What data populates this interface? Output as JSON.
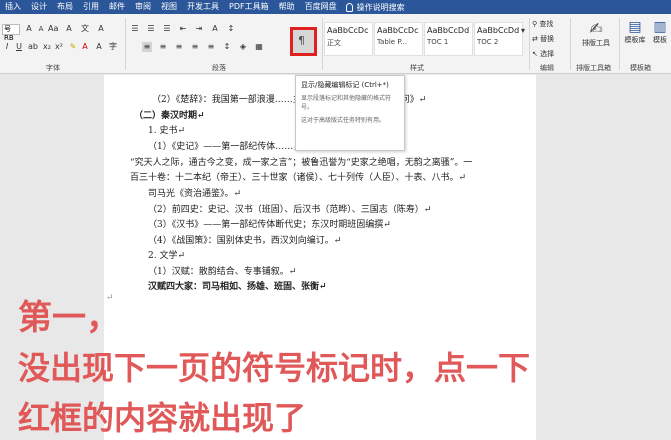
{
  "menubar": {
    "tabs": [
      "插入",
      "设计",
      "布局",
      "引用",
      "邮件",
      "审阅",
      "视图",
      "开发工具",
      "PDF工具箱",
      "帮助",
      "百度网盘"
    ],
    "search_label": "操作说明搜索"
  },
  "ribbon": {
    "font_name": "号 RB",
    "group_font": "字体",
    "group_paragraph": "段落",
    "group_styles": "样式",
    "group_edit": "编辑",
    "group_typeset": "排版工具箱",
    "group_template": "模板箱",
    "styles": [
      {
        "preview": "AaBbCcDc",
        "name": "正文"
      },
      {
        "preview": "AaBbCcDc",
        "name": "Table P..."
      },
      {
        "preview": "AaBbCcDd",
        "name": "TOC 1"
      },
      {
        "preview": "AaBbCcDd",
        "name": "TOC 2"
      }
    ],
    "find": "查找",
    "replace": "替换",
    "select": "选择",
    "typeset_tool": "排版工具",
    "template_lib": "模板库",
    "template_short": "模板"
  },
  "tooltip": {
    "title": "显示/隐藏编辑标记 (Ctrl+*)",
    "desc": "显示段落标记和其他隐藏的格式符号。",
    "note": "这对于高级版式任务特别有用。"
  },
  "document": {
    "lines": [
      "（2）《楚辞》：我国第一部浪漫……主要作者屈原，《离骚》《天问》↵",
      "（二）秦汉时期↵",
      "1. 史书↵",
      "（1）《史记》——第一部纪传体……，西汉武帝时期司马迁所著，",
      "“究天人之际，通古今之变，成一家之言”；被鲁迅誉为“史家之绝唱，无韵之离骚”。一",
      "百三十卷：十二本纪（帝王）、三十世家（诸侯）、七十列传（人臣）、十表、八书。↵",
      "司马光《资治通鉴》。↵",
      "（2）前四史：史记、汉书（班固）、后汉书（范晔）、三国志（陈寿）↵",
      "（3）《汉书》——第一部纪传体断代史；东汉时期班固编撰↵",
      "（4）《战国策》：国别体史书，西汉刘向编订。↵",
      "2. 文学↵",
      "（1）汉赋：散韵结合、专事铺叙。↵",
      "汉赋四大家：司马相如、扬雄、班固、张衡↵"
    ],
    "empty_mark": "↵"
  },
  "overlay": {
    "line1": "第一，",
    "line2": "没出现下一页的符号标记时，点一下",
    "line3": "红框的内容就出现了"
  },
  "colors": {
    "menubar": "#2b579a",
    "highlight_box": "#e02020",
    "overlay_text": "#e05858"
  }
}
